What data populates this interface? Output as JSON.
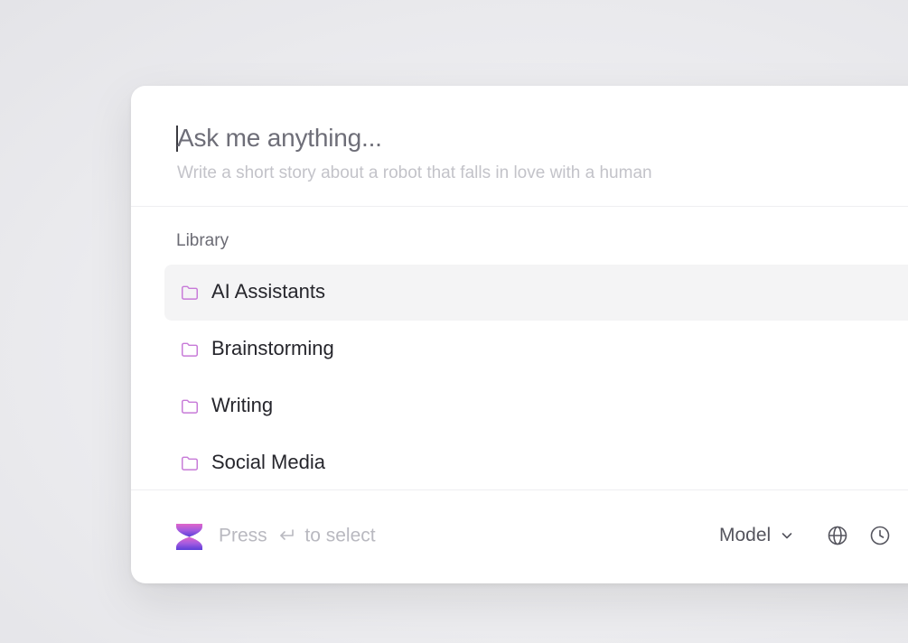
{
  "search": {
    "placeholder": "Ask me anything...",
    "suggestion": "Write a short story about a robot that falls in love with a human"
  },
  "library": {
    "heading": "Library",
    "items": [
      {
        "label": "AI Assistants",
        "icon": "folder-icon",
        "active": true
      },
      {
        "label": "Brainstorming",
        "icon": "folder-icon"
      },
      {
        "label": "Writing",
        "icon": "folder-icon"
      },
      {
        "label": "Social Media",
        "icon": "folder-icon"
      }
    ]
  },
  "footer": {
    "logo": "hourglass-logo",
    "hint_prefix": "Press",
    "hint_icon": "enter-icon",
    "hint_suffix": "to select",
    "model_label": "Model",
    "icons": [
      "chevron-down-icon",
      "globe-icon",
      "clock-icon"
    ]
  },
  "colors": {
    "accent": "#a656d6",
    "folder": "#c77ad8",
    "active_row": "#f4f4f5",
    "placeholder": "#6e6e78",
    "muted": "#b9b9c0"
  }
}
